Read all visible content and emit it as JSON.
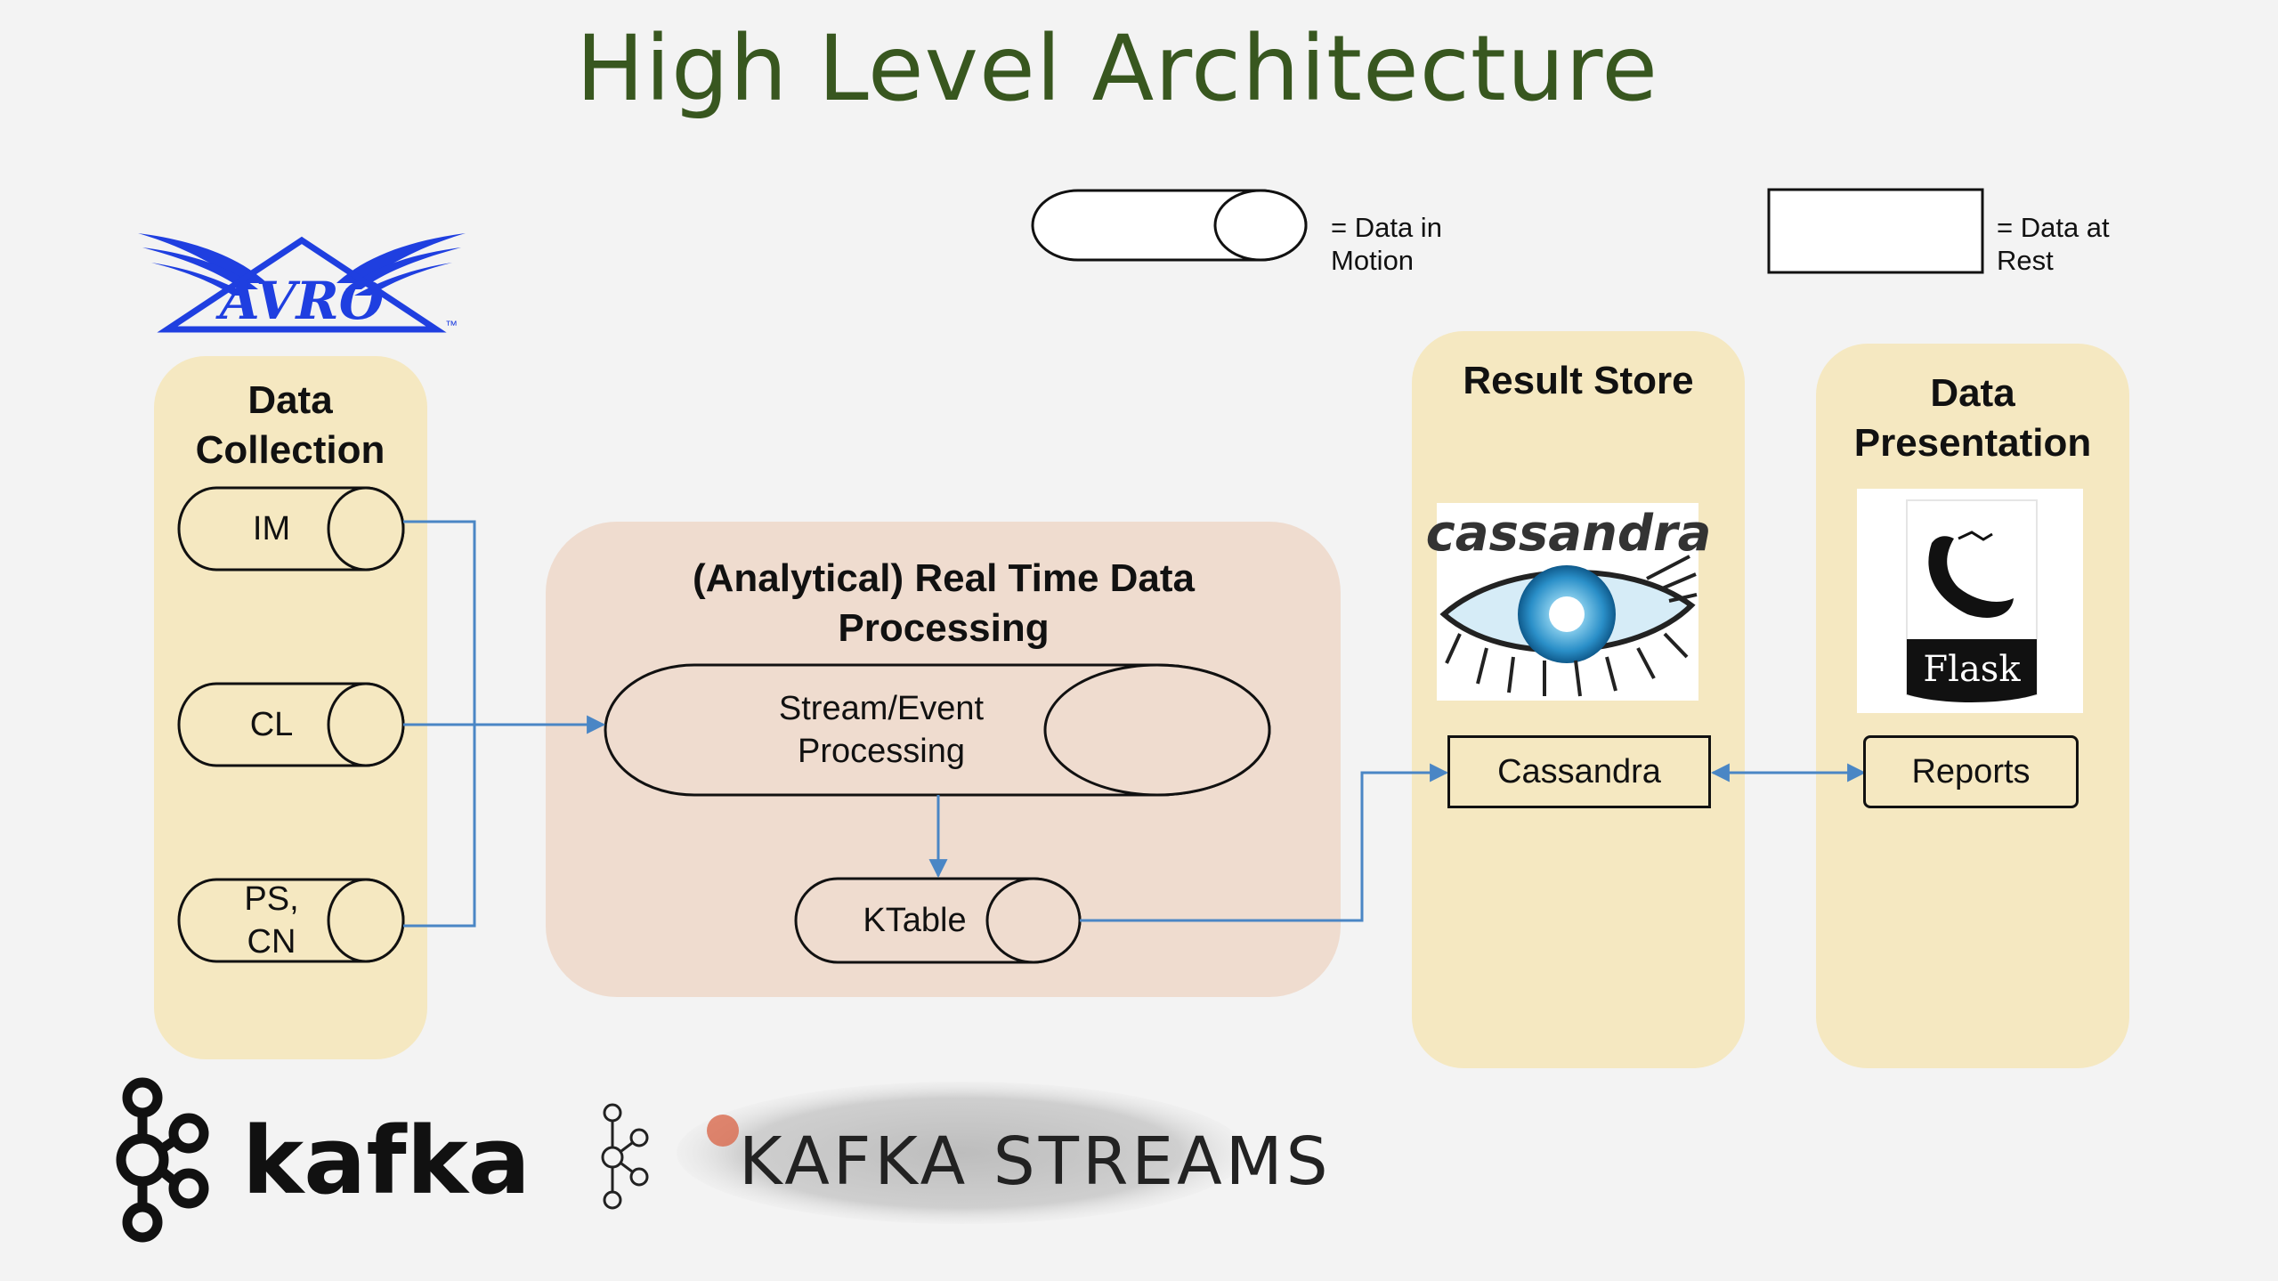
{
  "title": "High Level Architecture",
  "legend": {
    "motion_label": "= Data in Motion",
    "rest_label": "= Data at Rest"
  },
  "data_collection": {
    "heading": "Data Collection",
    "sources": [
      "IM",
      "CL",
      "PS, CN"
    ]
  },
  "processing": {
    "heading": "(Analytical) Real Time Data Processing",
    "stream_label": "Stream/Event Processing",
    "ktable_label": "KTable"
  },
  "result_store": {
    "heading": "Result Store",
    "logo_text": "cassandra",
    "box_label": "Cassandra"
  },
  "presentation": {
    "heading": "Data Presentation",
    "logo_text": "Flask",
    "box_label": "Reports"
  },
  "logos": {
    "avro": "AVRO",
    "avro_tm": "™",
    "kafka": "kafka",
    "kafka_streams": "KAFKA STREAMS"
  },
  "colors": {
    "title": "#38571f",
    "panel": "#f5e8c1",
    "processing_panel": "#efdccf",
    "arrow": "#4a86c5",
    "avro_blue": "#1f3fe0"
  }
}
